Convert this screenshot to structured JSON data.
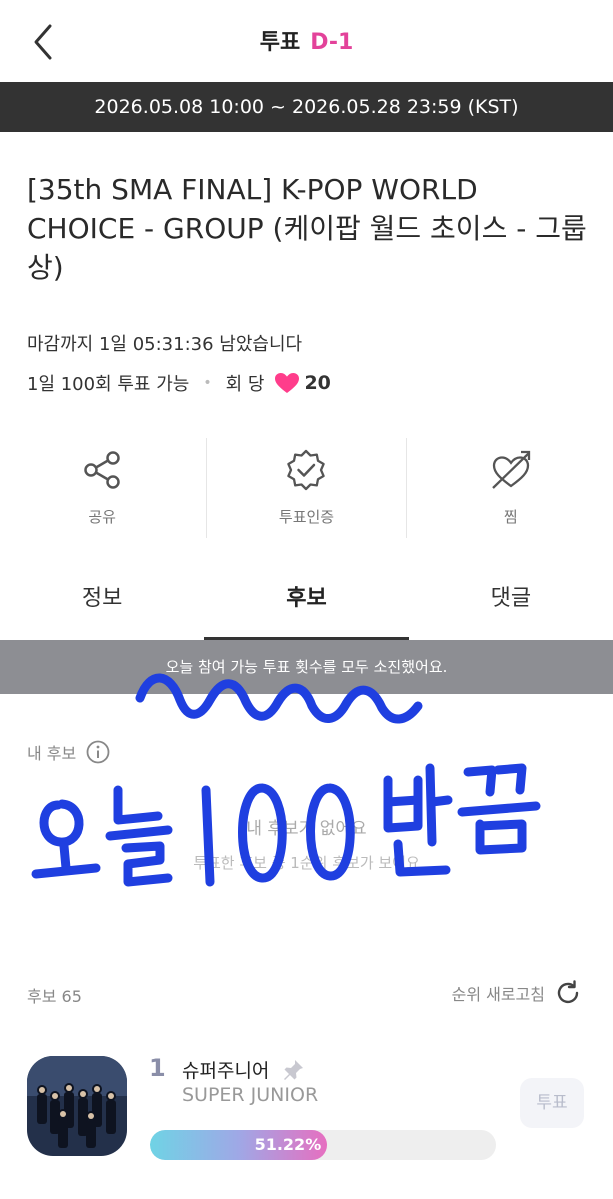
{
  "header": {
    "title": "투표",
    "dday": "D-1"
  },
  "period": "2026.05.08 10:00 ~ 2026.05.28 23:59 (KST)",
  "vote_title": "[35th SMA FINAL] K-POP WORLD CHOICE - GROUP (케이팝 월드 초이스 - 그룹상)",
  "deadline_text": "마감까지 1일 05:31:36 남았습니다",
  "limit": {
    "daily": "1일 100회 투표 가능",
    "dot": "•",
    "per_vote": "회 당",
    "points": "20",
    "heart_color": "#ff3d8b"
  },
  "actions": [
    {
      "label": "공유",
      "icon": "share-icon"
    },
    {
      "label": "투표인증",
      "icon": "verified-badge-icon"
    },
    {
      "label": "찜",
      "icon": "heart-arrow-icon"
    }
  ],
  "tabs": [
    {
      "label": "정보",
      "active": false
    },
    {
      "label": "후보",
      "active": true
    },
    {
      "label": "댓글",
      "active": false
    }
  ],
  "notice": "오늘 참여 가능 투표 횟수를 모두 소진했어요.",
  "my_candidate": {
    "label": "내 후보",
    "empty_title": "내 후보가 없어요",
    "empty_sub": "투표한 후보 중 1순위 후보가 보여요"
  },
  "handwriting": "오늘100번끝",
  "candidates_header": {
    "count_label": "후보 65",
    "refresh_label": "순위 새로고침"
  },
  "candidates": [
    {
      "rank": "1",
      "name": "슈퍼주니어",
      "name_en": "SUPER JUNIOR",
      "percent": 51.22,
      "percent_label": "51.22%",
      "vote_button": "투표"
    }
  ],
  "colors": {
    "accent": "#e3429a",
    "period_bar": "#333333",
    "notice_bar": "#8d8e93",
    "scribble": "#1f3fe0"
  }
}
